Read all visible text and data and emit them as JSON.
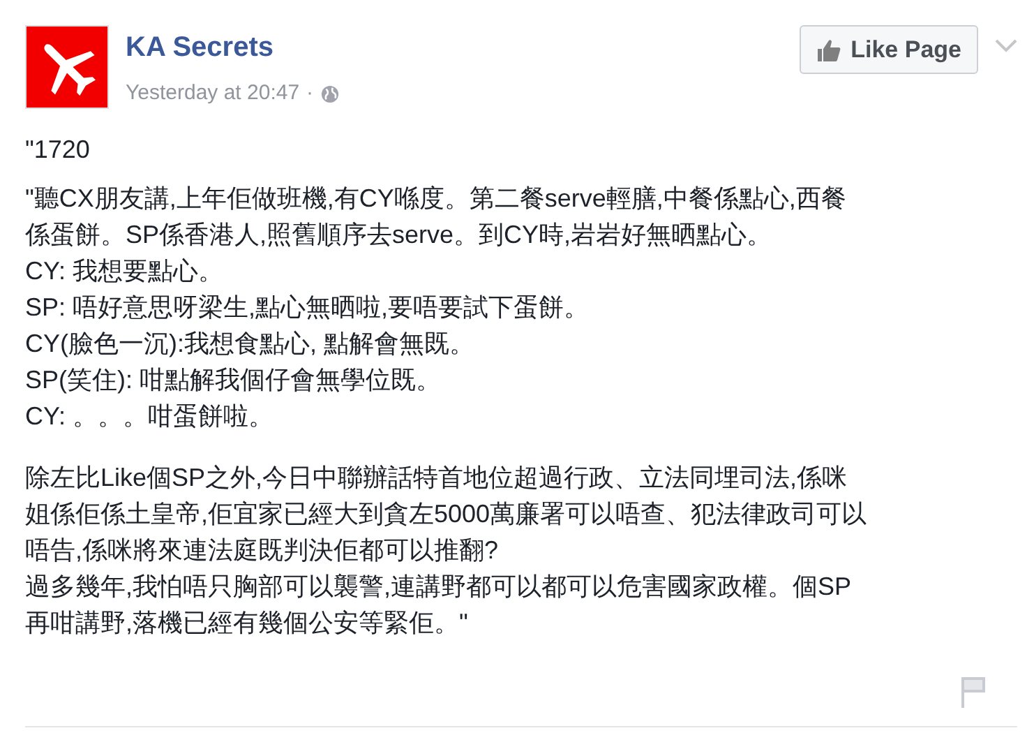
{
  "post": {
    "page_name": "KA Secrets",
    "timestamp": "Yesterday at 20:47",
    "separator": "·",
    "like_button": "Like Page",
    "paragraphs": [
      {
        "lines": [
          "\"1720"
        ]
      },
      {
        "lines": [
          "\"聽CX朋友講,上年佢做班機,有CY喺度。第二餐serve輕膳,中餐係點心,西餐",
          "係蛋餅。SP係香港人,照舊順序去serve。到CY時,岩岩好無晒點心。",
          "CY: 我想要點心。",
          "SP: 唔好意思呀梁生,點心無晒啦,要唔要試下蛋餅。",
          "CY(臉色一沉):我想食點心, 點解會無既。",
          "SP(笑住): 咁點解我個仔會無學位既。",
          "CY: 。。。咁蛋餅啦。"
        ]
      },
      {
        "lines": [
          "除左比Like個SP之外,今日中聯辦話特首地位超過行政、立法同埋司法,係咪",
          "姐係佢係土皇帝,佢宜家已經大到貪左5000萬廉署可以唔查、犯法律政司可以",
          "唔告,係咪將來連法庭既判決佢都可以推翻?",
          "過多幾年,我怕唔只胸部可以襲警,連講野都可以都可以危害國家政權。個SP",
          "再咁講野,落機已經有幾個公安等緊佢。\""
        ]
      }
    ]
  }
}
